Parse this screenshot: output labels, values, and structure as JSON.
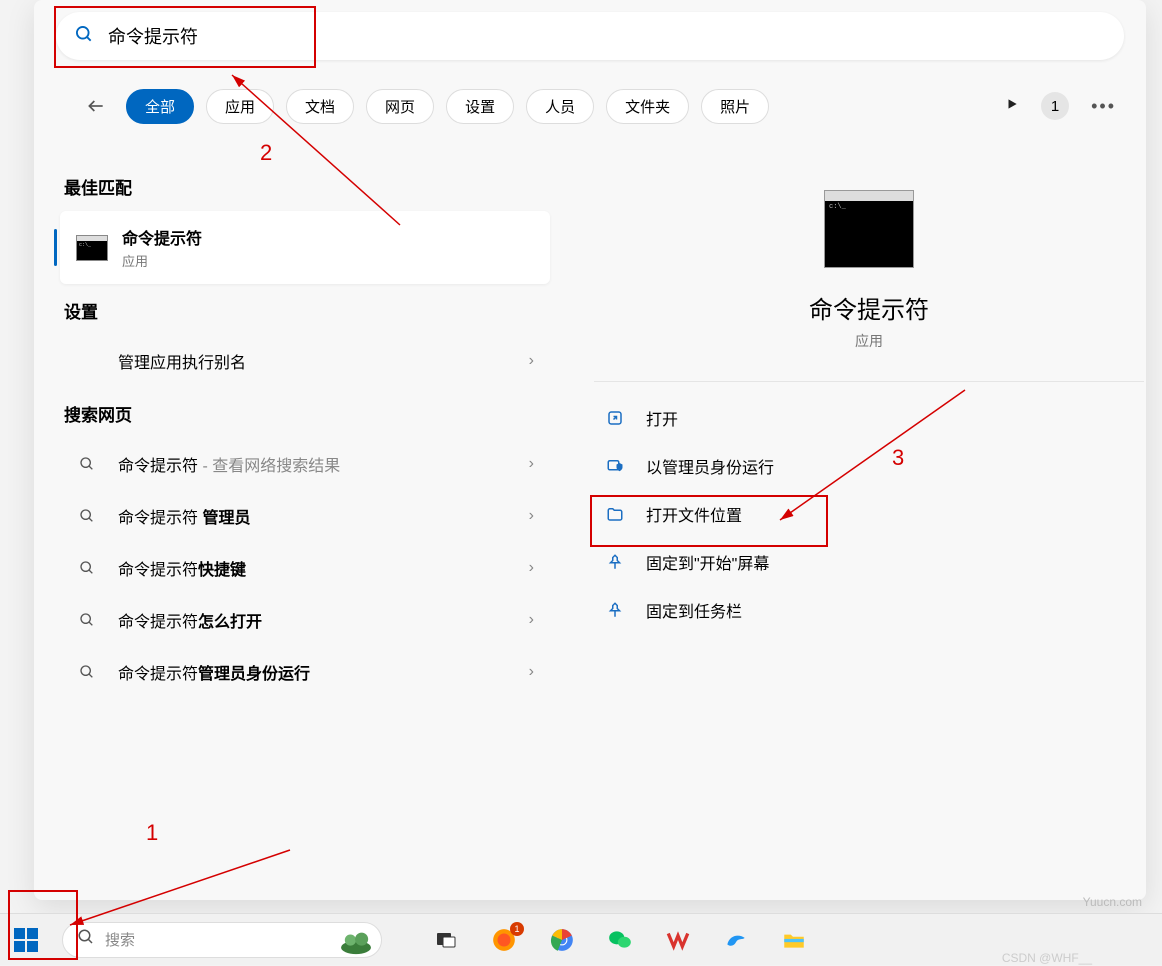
{
  "search": {
    "value": "命令提示符",
    "placeholder": "搜索"
  },
  "filters": {
    "items": [
      "全部",
      "应用",
      "文档",
      "网页",
      "设置",
      "人员",
      "文件夹",
      "照片"
    ],
    "badge": "1"
  },
  "left": {
    "best_label": "最佳匹配",
    "best_title": "命令提示符",
    "best_sub": "应用",
    "settings_label": "设置",
    "settings_item": "管理应用执行别名",
    "web_label": "搜索网页",
    "web_items": [
      {
        "prefix": "命令提示符",
        "bold": "",
        "hint": " - 查看网络搜索结果"
      },
      {
        "prefix": "命令提示符 ",
        "bold": "管理员",
        "hint": ""
      },
      {
        "prefix": "命令提示符",
        "bold": "快捷键",
        "hint": ""
      },
      {
        "prefix": "命令提示符",
        "bold": "怎么打开",
        "hint": ""
      },
      {
        "prefix": "命令提示符",
        "bold": "管理员身份运行",
        "hint": ""
      }
    ]
  },
  "right": {
    "title": "命令提示符",
    "sub": "应用",
    "actions": [
      {
        "icon": "open",
        "label": "打开"
      },
      {
        "icon": "admin",
        "label": "以管理员身份运行"
      },
      {
        "icon": "folder",
        "label": "打开文件位置"
      },
      {
        "icon": "pin",
        "label": "固定到\"开始\"屏幕"
      },
      {
        "icon": "pin",
        "label": "固定到任务栏"
      }
    ]
  },
  "taskbar": {
    "search_placeholder": "搜索",
    "notif_badge": "1"
  },
  "annotations": {
    "n1": "1",
    "n2": "2",
    "n3": "3"
  },
  "watermark1": "Yuucn.com",
  "watermark2": "CSDN @WHF__"
}
